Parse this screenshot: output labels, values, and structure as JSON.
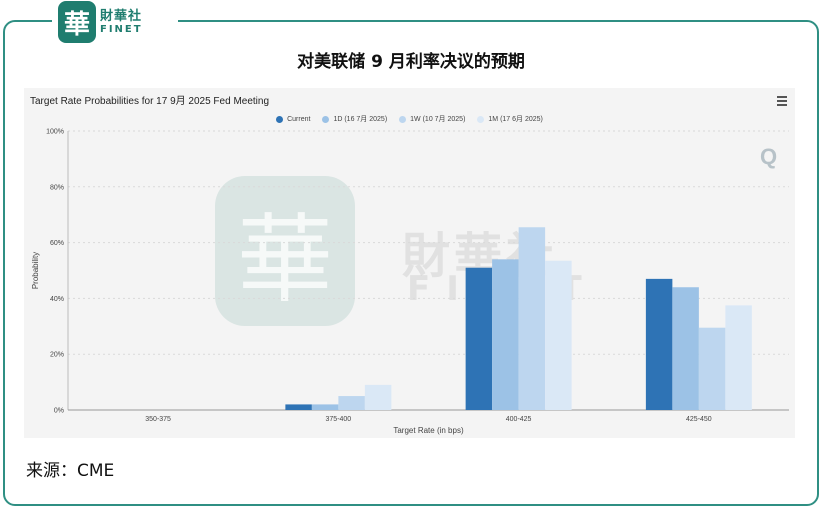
{
  "brand": {
    "seal_char": "華",
    "name_cn": "財華社",
    "name_en": "FINET",
    "colors": {
      "brand": "#1f7d6f",
      "frame": "#2f8f83"
    }
  },
  "page": {
    "title": "对美联储 9 月利率决议的预期",
    "source": "来源：CME"
  },
  "watermark": {
    "seal_char": "華",
    "cn": "財華社",
    "en": "FINET"
  },
  "chart_data": {
    "type": "bar",
    "title": "Target Rate Probabilities for 17 9月 2025 Fed Meeting",
    "xlabel": "Target Rate (in bps)",
    "ylabel": "Probability",
    "categories": [
      "350-375",
      "375-400",
      "400-425",
      "425-450"
    ],
    "ylim": [
      0,
      100
    ],
    "yticks": [
      "0%",
      "20%",
      "40%",
      "60%",
      "80%",
      "100%"
    ],
    "grid": true,
    "legend_position": "top-center",
    "series": [
      {
        "name": "Current",
        "color": "#2e73b5",
        "values": [
          0,
          2,
          51,
          47
        ]
      },
      {
        "name": "1D (16 7月 2025)",
        "color": "#9cc2e6",
        "values": [
          0,
          2,
          54,
          44
        ]
      },
      {
        "name": "1W (10 7月 2025)",
        "color": "#bdd6ef",
        "values": [
          0,
          5,
          65.5,
          29.5
        ]
      },
      {
        "name": "1M (17 6月 2025)",
        "color": "#dae8f6",
        "values": [
          0,
          9,
          53.5,
          37.5
        ]
      }
    ]
  }
}
